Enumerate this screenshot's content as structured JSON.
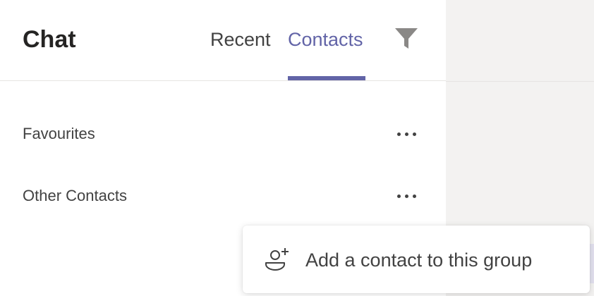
{
  "header": {
    "title": "Chat",
    "tabs": [
      {
        "label": "Recent",
        "active": false
      },
      {
        "label": "Contacts",
        "active": true
      }
    ],
    "filter_icon": "filter-icon"
  },
  "groups": [
    {
      "label": "Favourites",
      "more_icon": "more-options-icon"
    },
    {
      "label": "Other Contacts",
      "more_icon": "more-options-icon"
    }
  ],
  "context_menu": {
    "items": [
      {
        "label": "Add a contact to this group",
        "icon": "add-contact-icon"
      }
    ]
  },
  "colors": {
    "accent": "#6264a7",
    "text": "#424242",
    "background": "#f3f2f1"
  }
}
